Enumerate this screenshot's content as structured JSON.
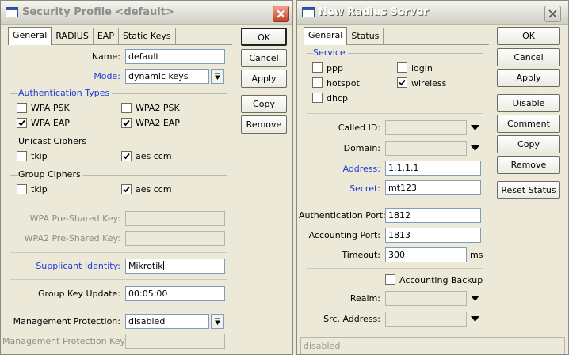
{
  "security_profile": {
    "title": "Security Profile <default>",
    "tabs": [
      "General",
      "RADIUS",
      "EAP",
      "Static Keys"
    ],
    "name_label": "Name:",
    "name_value": "default",
    "mode_label": "Mode:",
    "mode_value": "dynamic keys",
    "auth_section": "Authentication Types",
    "auth": {
      "wpa_psk": {
        "label": "WPA PSK",
        "checked": false
      },
      "wpa2_psk": {
        "label": "WPA2 PSK",
        "checked": false
      },
      "wpa_eap": {
        "label": "WPA EAP",
        "checked": true
      },
      "wpa2_eap": {
        "label": "WPA2 EAP",
        "checked": true
      }
    },
    "unicast_section": "Unicast Ciphers",
    "unicast": {
      "tkip": {
        "label": "tkip",
        "checked": false
      },
      "aes": {
        "label": "aes ccm",
        "checked": true
      }
    },
    "group_section": "Group Ciphers",
    "group": {
      "tkip": {
        "label": "tkip",
        "checked": false
      },
      "aes": {
        "label": "aes ccm",
        "checked": true
      }
    },
    "wpa_psk_key_label": "WPA Pre-Shared Key:",
    "wpa2_psk_key_label": "WPA2 Pre-Shared Key:",
    "supplicant_label": "Supplicant Identity:",
    "supplicant_value": "Mikrotik",
    "group_key_label": "Group Key Update:",
    "group_key_value": "00:05:00",
    "mgmt_prot_label": "Management Protection:",
    "mgmt_prot_value": "disabled",
    "mgmt_key_label": "Management Protection Key:",
    "buttons": {
      "ok": "OK",
      "cancel": "Cancel",
      "apply": "Apply",
      "copy": "Copy",
      "remove": "Remove"
    }
  },
  "radius_server": {
    "title": "New Radius Server",
    "tabs": [
      "General",
      "Status"
    ],
    "service_section": "Service",
    "services": {
      "ppp": {
        "label": "ppp",
        "checked": false
      },
      "login": {
        "label": "login",
        "checked": false
      },
      "hotspot": {
        "label": "hotspot",
        "checked": false
      },
      "wireless": {
        "label": "wireless",
        "checked": true
      },
      "dhcp": {
        "label": "dhcp",
        "checked": false
      }
    },
    "called_id_label": "Called ID:",
    "domain_label": "Domain:",
    "address_label": "Address:",
    "address_value": "1.1.1.1",
    "secret_label": "Secret:",
    "secret_value": "mt123",
    "auth_port_label": "Authentication Port:",
    "auth_port_value": "1812",
    "acct_port_label": "Accounting Port:",
    "acct_port_value": "1813",
    "timeout_label": "Timeout:",
    "timeout_value": "300",
    "timeout_unit": "ms",
    "acct_backup": {
      "label": "Accounting Backup",
      "checked": false
    },
    "realm_label": "Realm:",
    "src_address_label": "Src. Address:",
    "status_bar": "disabled",
    "buttons": {
      "ok": "OK",
      "cancel": "Cancel",
      "apply": "Apply",
      "disable": "Disable",
      "comment": "Comment",
      "copy": "Copy",
      "remove": "Remove",
      "reset_status": "Reset Status"
    }
  }
}
